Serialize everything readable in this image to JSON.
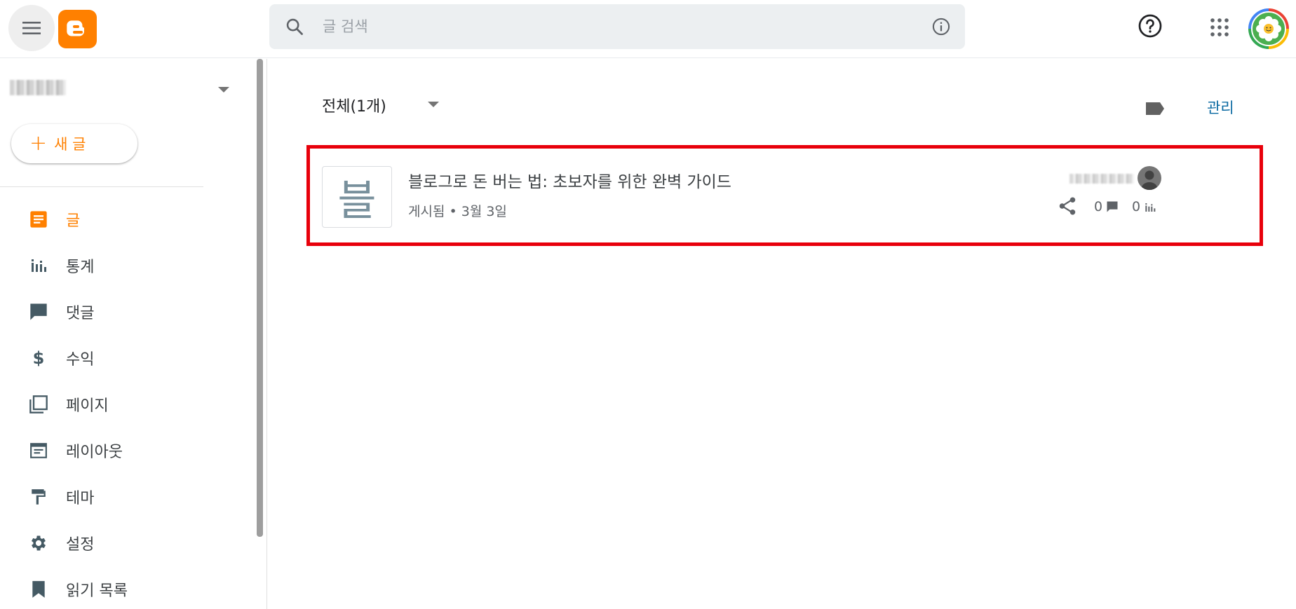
{
  "header": {
    "search_placeholder": "글 검색"
  },
  "sidebar": {
    "new_post": {
      "plus": "+",
      "label": "새 글"
    },
    "items": [
      {
        "label": "글",
        "icon": "posts-icon",
        "active": true
      },
      {
        "label": "통계",
        "icon": "stats-icon"
      },
      {
        "label": "댓글",
        "icon": "comment-icon"
      },
      {
        "label": "수익",
        "icon": "dollar-icon"
      },
      {
        "label": "페이지",
        "icon": "pages-icon"
      },
      {
        "label": "레이아웃",
        "icon": "layout-icon"
      },
      {
        "label": "테마",
        "icon": "paint-roller-icon"
      },
      {
        "label": "설정",
        "icon": "gear-icon"
      },
      {
        "label": "읽기 목록",
        "icon": "bookmark-icon"
      }
    ]
  },
  "main": {
    "filter_label": "전체(1개)",
    "manage_label": "관리",
    "posts": [
      {
        "thumb_char": "블",
        "title": "블로그로 돈 버는 법: 초보자를 위한 완벽 가이드",
        "meta": "게시됨 • 3월 3일",
        "comments": "0",
        "views": "0"
      }
    ]
  },
  "colors": {
    "brand": "#ff8000",
    "highlight_border": "#e8000b",
    "link": "#0b6aa2"
  }
}
